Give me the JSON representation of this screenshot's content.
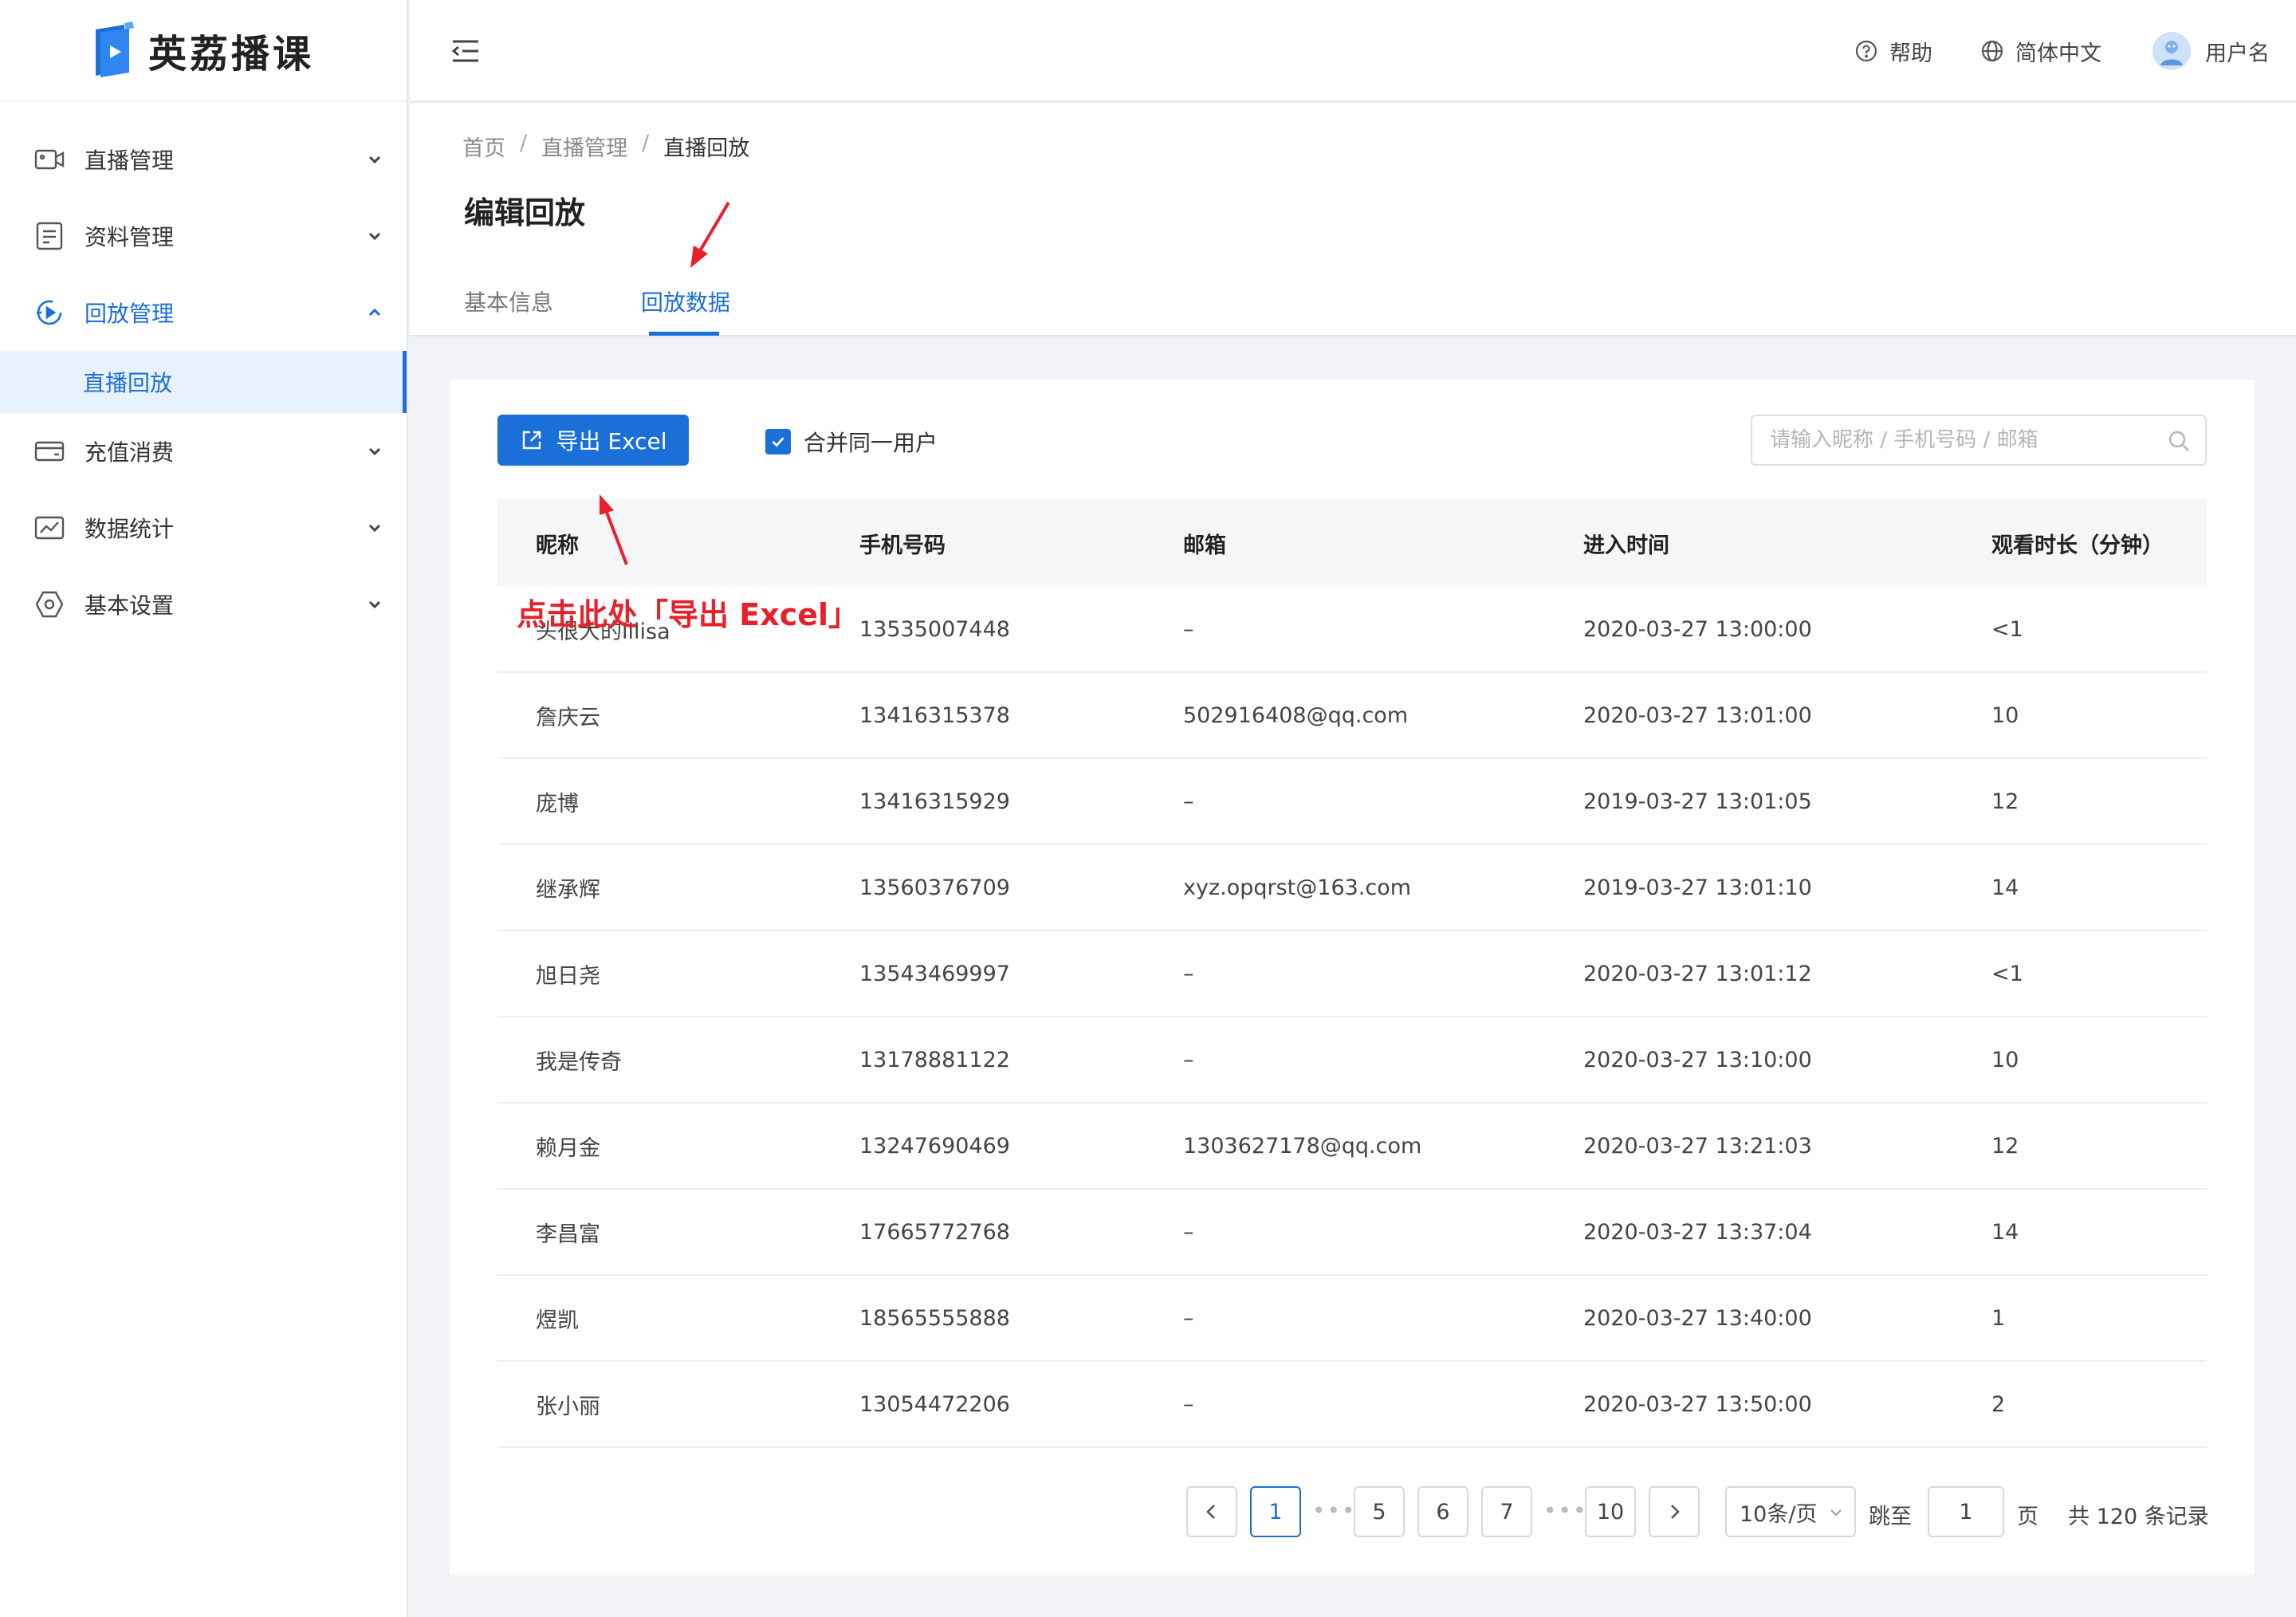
{
  "app": {
    "name": "英荔播课"
  },
  "sidebar": {
    "items": [
      {
        "label": "直播管理",
        "icon": "video-camera-icon"
      },
      {
        "label": "资料管理",
        "icon": "document-icon"
      },
      {
        "label": "回放管理",
        "icon": "replay-icon",
        "expanded": true
      },
      {
        "label": "充值消费",
        "icon": "wallet-icon"
      },
      {
        "label": "数据统计",
        "icon": "chart-icon"
      },
      {
        "label": "基本设置",
        "icon": "settings-icon"
      }
    ],
    "sub_item": {
      "label": "直播回放"
    }
  },
  "header": {
    "help": "帮助",
    "language": "简体中文",
    "username": "用户名"
  },
  "breadcrumb": [
    "首页",
    "直播管理",
    "直播回放"
  ],
  "page": {
    "title": "编辑回放",
    "tabs": [
      "基本信息",
      "回放数据"
    ]
  },
  "toolbar": {
    "export_label": "导出 Excel",
    "merge_label": "合并同一用户",
    "merge_checked": true,
    "search_placeholder": "请输入昵称 / 手机号码 / 邮箱"
  },
  "table": {
    "columns": [
      "昵称",
      "手机号码",
      "邮箱",
      "进入时间",
      "观看时长（分钟）"
    ],
    "rows": [
      [
        "头很大的lilisa",
        "13535007448",
        "–",
        "2020-03-27 13:00:00",
        "<1"
      ],
      [
        "詹庆云",
        "13416315378",
        "502916408@qq.com",
        "2020-03-27 13:01:00",
        "10"
      ],
      [
        "庞博",
        "13416315929",
        "–",
        "2019-03-27 13:01:05",
        "12"
      ],
      [
        "继承辉",
        "13560376709",
        "xyz.opqrst@163.com",
        "2019-03-27 13:01:10",
        "14"
      ],
      [
        "旭日尧",
        "13543469997",
        "–",
        "2020-03-27 13:01:12",
        "<1"
      ],
      [
        "我是传奇",
        "13178881122",
        "–",
        "2020-03-27 13:10:00",
        "10"
      ],
      [
        "赖月金",
        "13247690469",
        "1303627178@qq.com",
        "2020-03-27 13:21:03",
        "12"
      ],
      [
        "李昌富",
        "17665772768",
        "–",
        "2020-03-27 13:37:04",
        "14"
      ],
      [
        "煜凯",
        "18565555888",
        "–",
        "2020-03-27 13:40:00",
        "1"
      ],
      [
        "张小丽",
        "13054472206",
        "–",
        "2020-03-27 13:50:00",
        "2"
      ]
    ]
  },
  "pagination": {
    "pages": [
      "1",
      "5",
      "6",
      "7",
      "10"
    ],
    "current": "1",
    "page_size": "10条/页",
    "jump_label": "跳至",
    "jump_value": "1",
    "page_unit": "页",
    "total": "共 120 条记录"
  },
  "annotation": {
    "text": "点击此处「导出 Excel」"
  },
  "colors": {
    "accent": "#1a6fd9",
    "annotation": "#e8202a"
  }
}
